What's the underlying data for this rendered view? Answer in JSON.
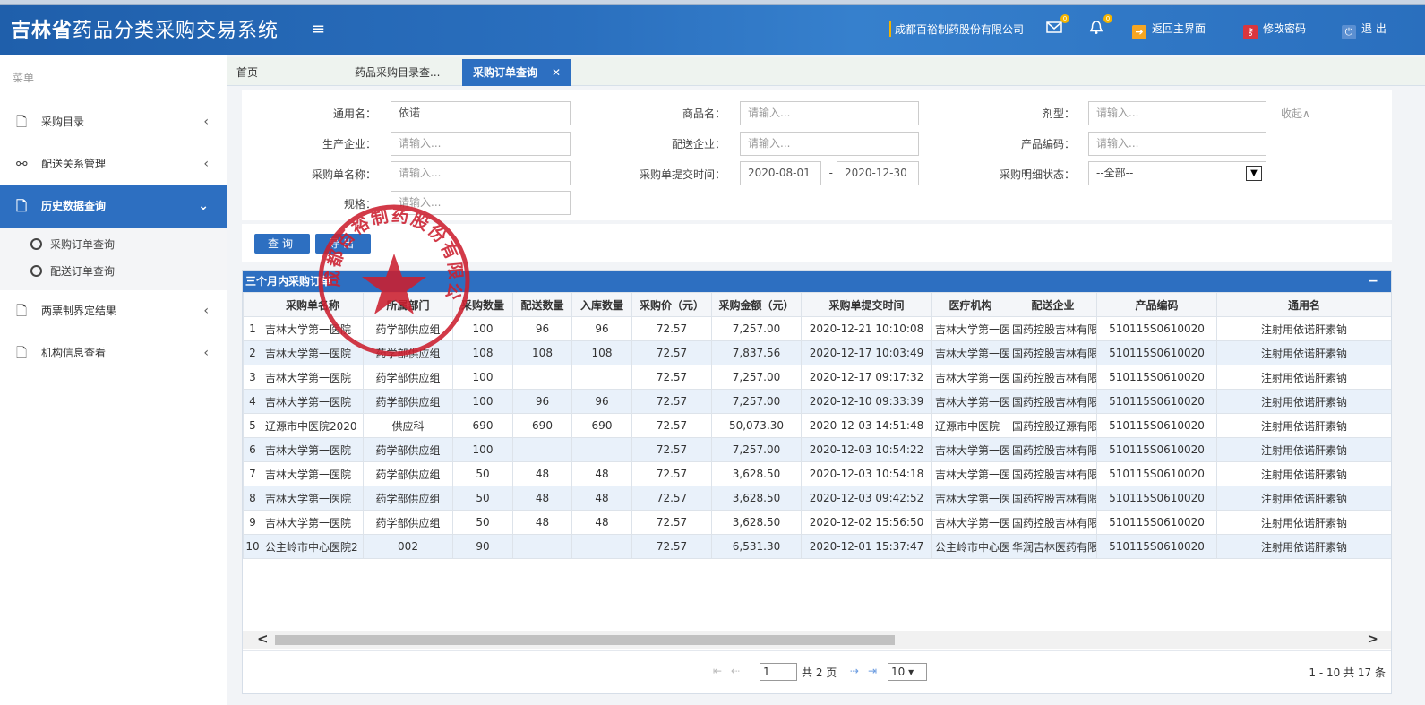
{
  "header": {
    "title_bold": "吉林省",
    "title_rest": "药品分类采购交易系统",
    "menu_icon": "≡",
    "company": "成都百裕制药股份有限公司",
    "mail_badge": "0",
    "bell_badge": "0",
    "home_label": "返回主界面",
    "password_label": "修改密码",
    "logout_label": "退 出"
  },
  "sidebar": {
    "heading": "菜单",
    "items": [
      {
        "label": "采购目录",
        "icon": "doc-icon"
      },
      {
        "label": "配送关系管理",
        "icon": "link-icon"
      },
      {
        "label": "历史数据查询",
        "icon": "doc-icon"
      },
      {
        "label": "两票制界定结果",
        "icon": "doc-icon"
      },
      {
        "label": "机构信息查看",
        "icon": "doc-icon"
      }
    ],
    "sub_items": [
      {
        "label": "采购订单查询"
      },
      {
        "label": "配送订单查询"
      }
    ]
  },
  "tabs": [
    {
      "label": "首页"
    },
    {
      "label": "药品采购目录查..."
    },
    {
      "label": "采购订单查询"
    }
  ],
  "search": {
    "generic_name_label": "通用名：",
    "generic_name_value": "依诺",
    "trade_name_label": "商品名：",
    "trade_name_placeholder": "请输入...",
    "dosage_label": "剂型：",
    "dosage_placeholder": "请输入...",
    "collapse_label": "收起∧",
    "manufacturer_label": "生产企业：",
    "manufacturer_placeholder": "请输入...",
    "distributor_label": "配送企业：",
    "distributor_placeholder": "请输入...",
    "product_code_label": "产品编码：",
    "product_code_placeholder": "请输入...",
    "order_name_label": "采购单名称：",
    "order_name_placeholder": "请输入...",
    "submit_time_label": "采购单提交时间：",
    "date_from": "2020-08-01",
    "date_sep": "-",
    "date_to": "2020-12-30",
    "detail_status_label": "采购明细状态：",
    "detail_status_value": "--全部--",
    "spec_label": "规格：",
    "spec_placeholder": "请输入..."
  },
  "buttons": {
    "query": "查询",
    "export": "导出"
  },
  "grid": {
    "title": "三个月内采购订单",
    "columns": [
      "采购单名称",
      "所属部门",
      "采购数量",
      "配送数量",
      "入库数量",
      "采购价（元）",
      "采购金额（元）",
      "采购单提交时间",
      "医疗机构",
      "配送企业",
      "产品编码",
      "通用名"
    ],
    "rows": [
      {
        "n": "1",
        "c": [
          "吉林大学第一医院",
          "药学部供应组",
          "100",
          "96",
          "96",
          "72.57",
          "7,257.00",
          "2020-12-21 10:10:08",
          "吉林大学第一医",
          "国药控股吉林有限",
          "510115S0610020",
          "注射用依诺肝素钠"
        ]
      },
      {
        "n": "2",
        "c": [
          "吉林大学第一医院",
          "药学部供应组",
          "108",
          "108",
          "108",
          "72.57",
          "7,837.56",
          "2020-12-17 10:03:49",
          "吉林大学第一医",
          "国药控股吉林有限",
          "510115S0610020",
          "注射用依诺肝素钠"
        ]
      },
      {
        "n": "3",
        "c": [
          "吉林大学第一医院",
          "药学部供应组",
          "100",
          "",
          "",
          "72.57",
          "7,257.00",
          "2020-12-17 09:17:32",
          "吉林大学第一医",
          "国药控股吉林有限",
          "510115S0610020",
          "注射用依诺肝素钠"
        ]
      },
      {
        "n": "4",
        "c": [
          "吉林大学第一医院",
          "药学部供应组",
          "100",
          "96",
          "96",
          "72.57",
          "7,257.00",
          "2020-12-10 09:33:39",
          "吉林大学第一医",
          "国药控股吉林有限",
          "510115S0610020",
          "注射用依诺肝素钠"
        ]
      },
      {
        "n": "5",
        "c": [
          "辽源市中医院2020",
          "供应科",
          "690",
          "690",
          "690",
          "72.57",
          "50,073.30",
          "2020-12-03 14:51:48",
          "辽源市中医院",
          "国药控股辽源有限",
          "510115S0610020",
          "注射用依诺肝素钠"
        ]
      },
      {
        "n": "6",
        "c": [
          "吉林大学第一医院",
          "药学部供应组",
          "100",
          "",
          "",
          "72.57",
          "7,257.00",
          "2020-12-03 10:54:22",
          "吉林大学第一医",
          "国药控股吉林有限",
          "510115S0610020",
          "注射用依诺肝素钠"
        ]
      },
      {
        "n": "7",
        "c": [
          "吉林大学第一医院",
          "药学部供应组",
          "50",
          "48",
          "48",
          "72.57",
          "3,628.50",
          "2020-12-03 10:54:18",
          "吉林大学第一医",
          "国药控股吉林有限",
          "510115S0610020",
          "注射用依诺肝素钠"
        ]
      },
      {
        "n": "8",
        "c": [
          "吉林大学第一医院",
          "药学部供应组",
          "50",
          "48",
          "48",
          "72.57",
          "3,628.50",
          "2020-12-03 09:42:52",
          "吉林大学第一医",
          "国药控股吉林有限",
          "510115S0610020",
          "注射用依诺肝素钠"
        ]
      },
      {
        "n": "9",
        "c": [
          "吉林大学第一医院",
          "药学部供应组",
          "50",
          "48",
          "48",
          "72.57",
          "3,628.50",
          "2020-12-02 15:56:50",
          "吉林大学第一医",
          "国药控股吉林有限",
          "510115S0610020",
          "注射用依诺肝素钠"
        ]
      },
      {
        "n": "10",
        "c": [
          "公主岭市中心医院2",
          "002",
          "90",
          "",
          "",
          "72.57",
          "6,531.30",
          "2020-12-01 15:37:47",
          "公主岭市中心医",
          "华润吉林医药有限",
          "510115S0610020",
          "注射用依诺肝素钠"
        ]
      }
    ]
  },
  "pager": {
    "page_value": "1",
    "total_pages": "共 2 页",
    "page_size": "10",
    "summary": "1 - 10  共 17 条"
  },
  "seal": {
    "text": "成都百裕制药股份有限公司"
  },
  "colors": {
    "header_blue": "#2a6fbe",
    "accent_blue": "#2d6fc1",
    "seal_red": "#cc1f2f",
    "badge_yellow": "#f5b400"
  }
}
